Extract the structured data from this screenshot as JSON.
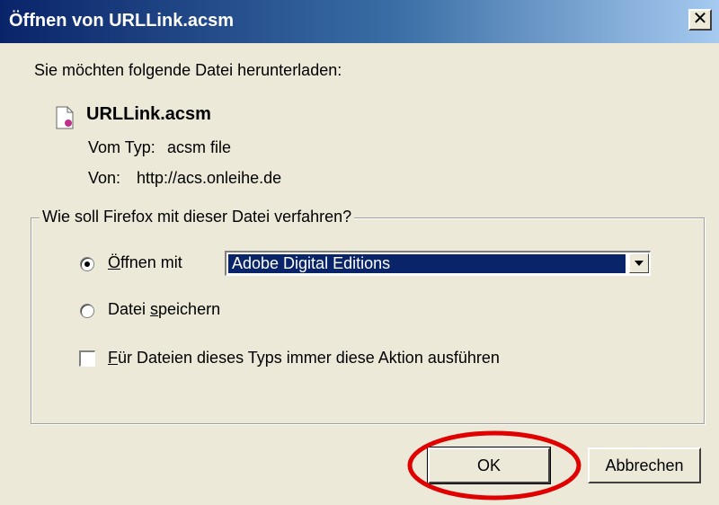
{
  "dialog": {
    "title": "Öffnen von URLLink.acsm",
    "close_label": "✕"
  },
  "body": {
    "intro": "Sie möchten folgende Datei herunterladen:",
    "file_name": "URLLink.acsm",
    "type_label": "Vom Typ:",
    "type_value": "acsm file",
    "from_label": "Von:",
    "from_value": "http://acs.onleihe.de"
  },
  "action_group": {
    "legend": "Wie soll Firefox mit dieser Datei verfahren?",
    "open_with": {
      "label_underlined": "Ö",
      "label_rest": "ffnen mit",
      "checked": true
    },
    "open_with_app": "Adobe Digital Editions",
    "save_file": {
      "label_before": "Datei ",
      "label_underlined": "s",
      "label_rest": "peichern",
      "checked": false
    },
    "always_do": {
      "label_underlined": "F",
      "label_rest": "ür Dateien dieses Typs immer diese Aktion ausführen",
      "checked": false
    }
  },
  "buttons": {
    "ok": "OK",
    "cancel": "Abbrechen"
  },
  "colors": {
    "title_bar_start": "#0a246a",
    "title_bar_end": "#a6caf0",
    "highlight_circle": "#e00000",
    "dialog_bg": "#ece9d8"
  },
  "icons": {
    "file": "file-icon",
    "close": "close-icon",
    "dropdown": "chevron-down-icon"
  }
}
